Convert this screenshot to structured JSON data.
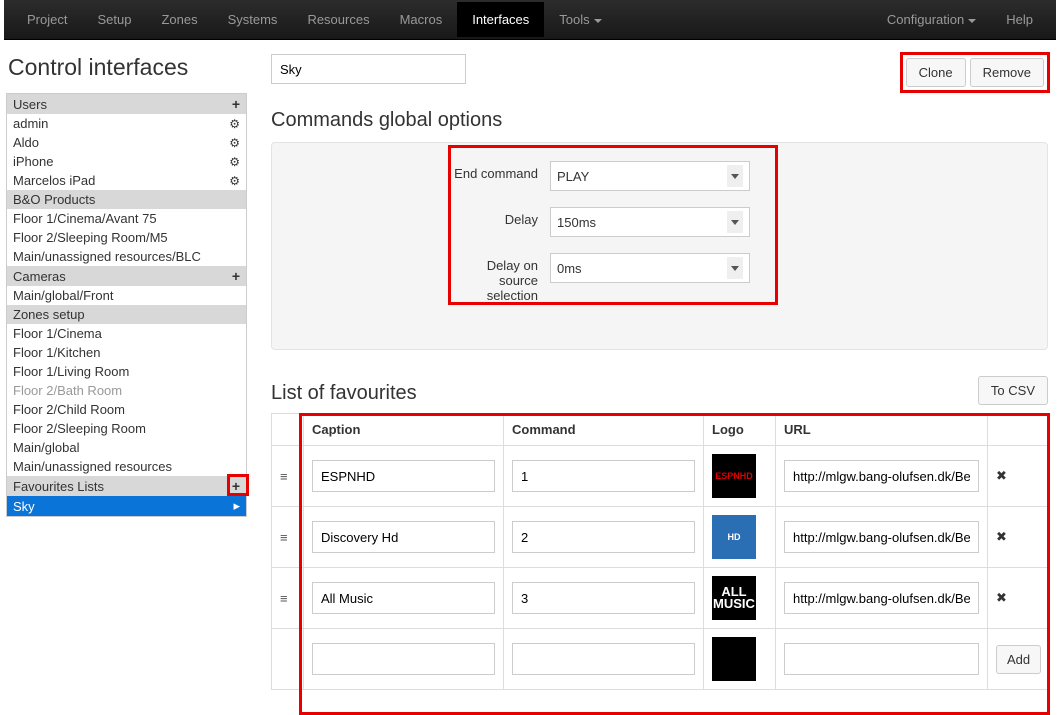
{
  "nav": {
    "left": [
      "Project",
      "Setup",
      "Zones",
      "Systems",
      "Resources",
      "Macros",
      "Interfaces",
      "Tools"
    ],
    "active_index": 6,
    "right": [
      "Configuration",
      "Help"
    ]
  },
  "sidebar": {
    "title": "Control interfaces",
    "groups": [
      {
        "header": "Users",
        "has_plus": true,
        "items": [
          {
            "label": "admin",
            "gear": true
          },
          {
            "label": "Aldo",
            "gear": true
          },
          {
            "label": "iPhone",
            "gear": true
          },
          {
            "label": "Marcelos iPad",
            "gear": true
          }
        ]
      },
      {
        "header": "B&O Products",
        "has_plus": false,
        "items": [
          {
            "label": "Floor 1/Cinema/Avant 75"
          },
          {
            "label": "Floor 2/Sleeping Room/M5"
          },
          {
            "label": "Main/unassigned resources/BLC"
          }
        ]
      },
      {
        "header": "Cameras",
        "has_plus": true,
        "items": [
          {
            "label": "Main/global/Front"
          }
        ]
      },
      {
        "header": "Zones setup",
        "has_plus": false,
        "items": [
          {
            "label": "Floor 1/Cinema"
          },
          {
            "label": "Floor 1/Kitchen"
          },
          {
            "label": "Floor 1/Living Room"
          },
          {
            "label": "Floor 2/Bath Room",
            "muted": true
          },
          {
            "label": "Floor 2/Child Room"
          },
          {
            "label": "Floor 2/Sleeping Room"
          },
          {
            "label": "Main/global"
          },
          {
            "label": "Main/unassigned resources"
          }
        ]
      },
      {
        "header": "Favourites Lists",
        "has_plus": true,
        "highlight_plus": true,
        "items": [
          {
            "label": "Sky",
            "selected": true
          }
        ]
      }
    ]
  },
  "main": {
    "name_value": "Sky",
    "clone": "Clone",
    "remove": "Remove",
    "commands_heading": "Commands global options",
    "form": {
      "end_command_label": "End command",
      "end_command_value": "PLAY",
      "delay_label": "Delay",
      "delay_value": "150ms",
      "delay_src_label": "Delay on source selection",
      "delay_src_value": "0ms"
    },
    "fav_heading": "List of favourites",
    "to_csv": "To CSV",
    "table": {
      "headers": {
        "caption": "Caption",
        "command": "Command",
        "logo": "Logo",
        "url": "URL"
      },
      "rows": [
        {
          "caption": "ESPNHD",
          "command": "1",
          "url": "http://mlgw.bang-olufsen.dk/Bec",
          "logo_text": "ESPNHD"
        },
        {
          "caption": "Discovery Hd",
          "command": "2",
          "url": "http://mlgw.bang-olufsen.dk/Bec",
          "logo_text": "HD"
        },
        {
          "caption": "All Music",
          "command": "3",
          "url": "http://mlgw.bang-olufsen.dk/Bec",
          "logo_text": "ALL\nMUSIC"
        }
      ],
      "add": "Add"
    }
  }
}
